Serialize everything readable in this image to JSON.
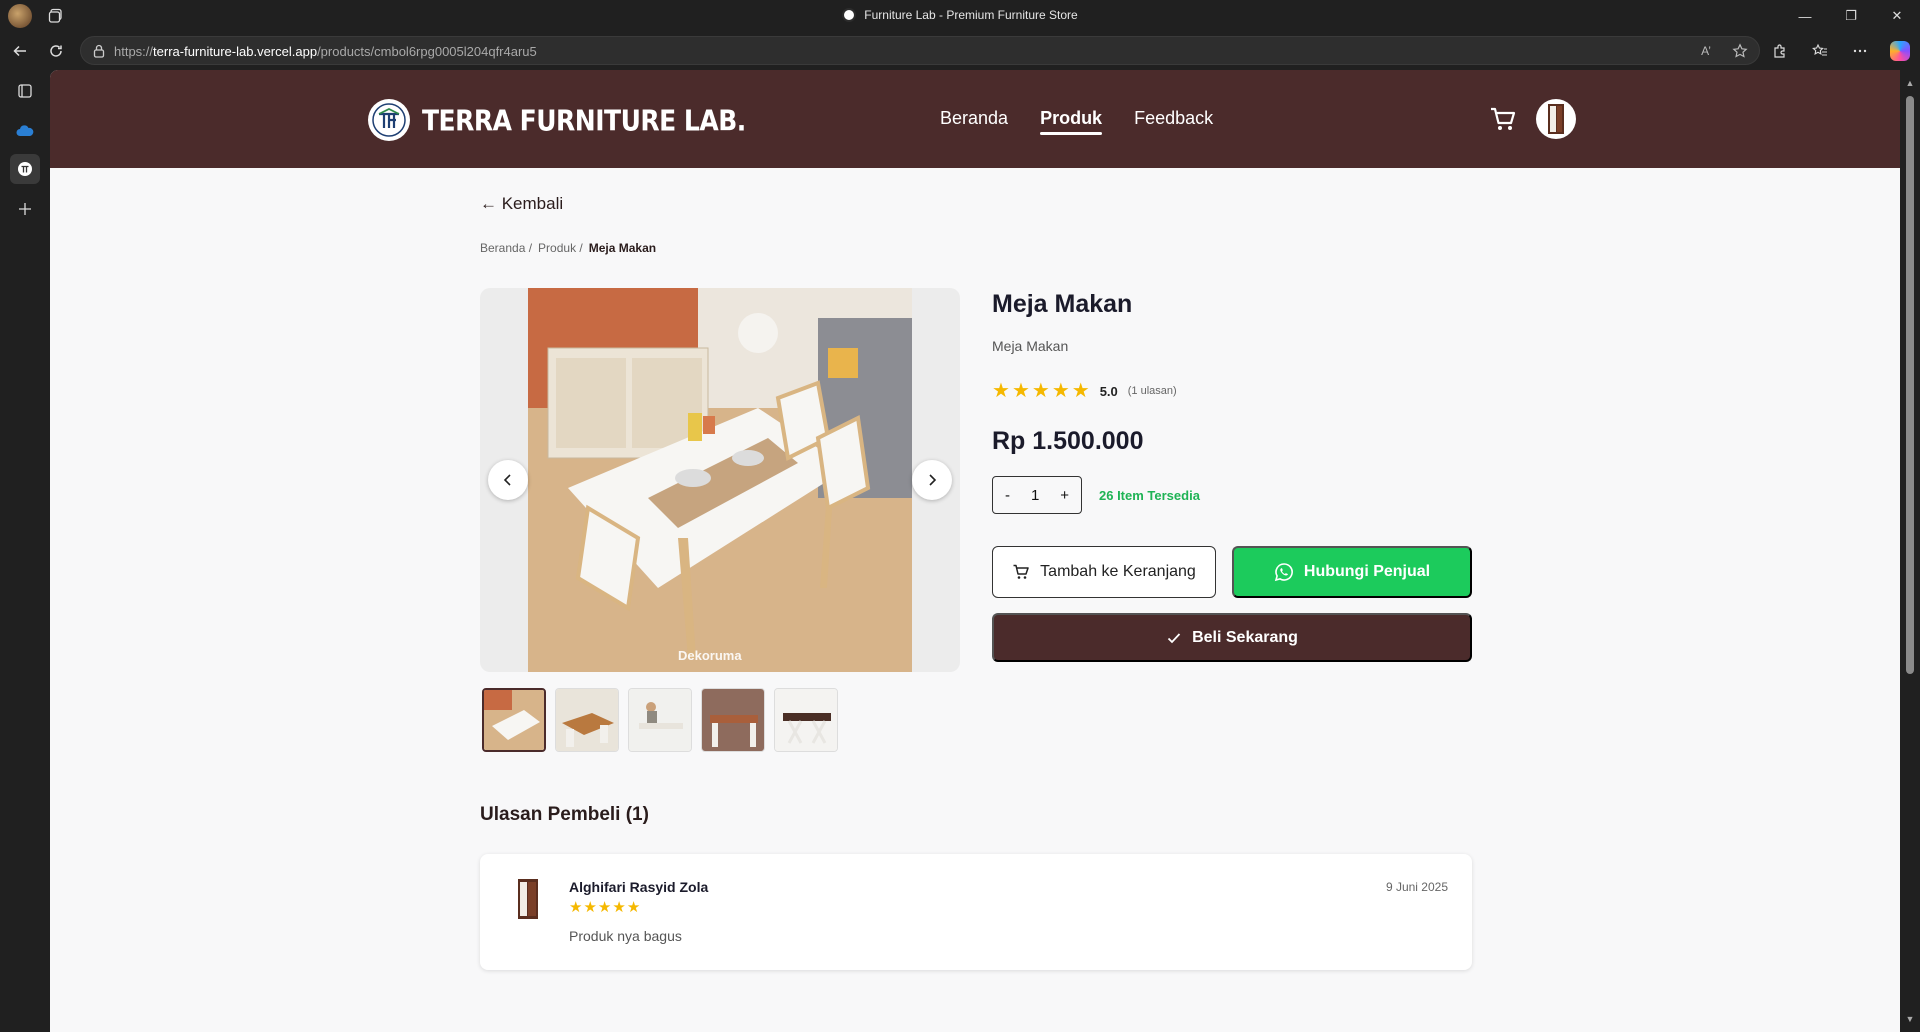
{
  "browser": {
    "tab_title": "Furniture Lab - Premium Furniture Store",
    "url_prefix": "https://",
    "url_host": "terra-furniture-lab.vercel.app",
    "url_path": "/products/cmbol6rpg0005l204qfr4aru5",
    "read_aloud_label": "A’",
    "window_controls": {
      "minimize": "—",
      "restore": "❐",
      "close": "✕"
    }
  },
  "site": {
    "brand": "TERRA FURNITURE LAB.",
    "nav": [
      {
        "label": "Beranda",
        "active": false
      },
      {
        "label": "Produk",
        "active": true
      },
      {
        "label": "Feedback",
        "active": false
      }
    ],
    "colors": {
      "brand": "#4b2b2b",
      "whatsapp": "#1ccb5c",
      "star": "#f5b800",
      "stock": "#1fb355"
    }
  },
  "page": {
    "back_label": "← Kembali",
    "breadcrumb": [
      "Beranda /",
      "Produk /",
      "Meja Makan"
    ],
    "gallery": {
      "prev_icon": "chevron-left-icon",
      "next_icon": "chevron-right-icon",
      "watermark": "Dekoruma",
      "thumb_count": 5,
      "active_thumb": 1
    },
    "product": {
      "title": "Meja Makan",
      "subtitle": "Meja Makan",
      "rating": 5.0,
      "rating_label": "5.0",
      "review_count_label": "(1 ulasan)",
      "price": "Rp 1.500.000",
      "qty_minus": "-",
      "qty_value": "1",
      "qty_plus": "+",
      "stock_label": "26 Item Tersedia"
    },
    "buttons": {
      "add_to_cart": "Tambah ke Keranjang",
      "contact_seller": "Hubungi Penjual",
      "buy_now": "Beli Sekarang"
    },
    "reviews": {
      "title": "Ulasan Pembeli (1)",
      "items": [
        {
          "name": "Alghifari Rasyid Zola",
          "rating": 5,
          "text": "Produk nya bagus",
          "date": "9 Juni 2025"
        }
      ]
    }
  }
}
